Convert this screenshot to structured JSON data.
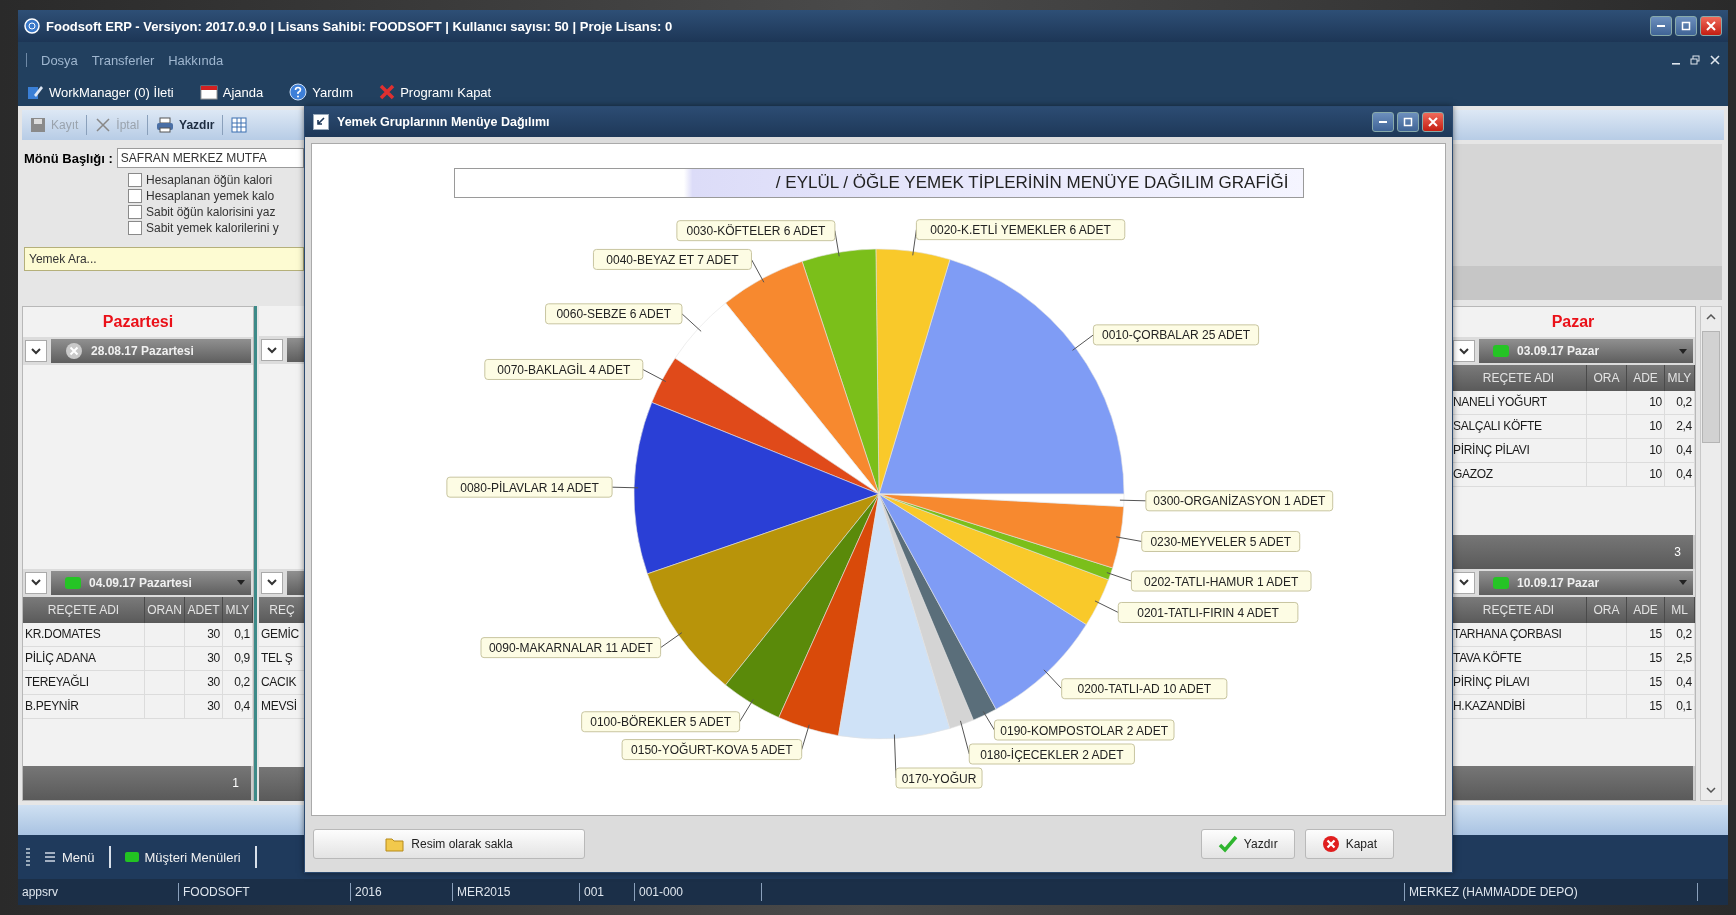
{
  "window": {
    "title": "Foodsoft ERP - Versiyon: 2017.0.9.0 | Lisans Sahibi: FOODSOFT | Kullanıcı sayısı: 50 | Proje Lisans: 0"
  },
  "menu": [
    "Dosya",
    "Transferler",
    "Hakkında"
  ],
  "toolbar": [
    {
      "label": "WorkManager (0) İleti",
      "kind": "workmanager"
    },
    {
      "label": "Ajanda",
      "kind": "calendar"
    },
    {
      "label": "Yardım",
      "kind": "help"
    },
    {
      "label": "Programı Kapat",
      "kind": "exit"
    }
  ],
  "edit_toolbar": [
    {
      "label": "Kayıt",
      "kind": "save",
      "disabled": true
    },
    {
      "label": "İptal",
      "kind": "cancel",
      "disabled": true
    },
    {
      "label": "Yazdır",
      "kind": "print",
      "disabled": false
    }
  ],
  "form": {
    "label": "Mönü Başlığı :",
    "value": "SAFRAN MERKEZ MUTFA",
    "options": [
      {
        "label": "Hesaplanan öğün kalori",
        "checked": false
      },
      {
        "label": "Hesaplanan yemek kalo",
        "checked": false
      },
      {
        "label": "Sabit öğün kalorisini yaz",
        "checked": false
      },
      {
        "label": "Sabit yemek kalorilerini y",
        "checked": false
      }
    ],
    "search": {
      "placeholder": "Yemek Ara..."
    }
  },
  "left_day": {
    "day": "Pazartesi",
    "blocks": [
      {
        "date": "28.08.17 Pazartesi",
        "kind": "closed"
      },
      {
        "date": "04.09.17 Pazartesi",
        "kind": "active",
        "columns": [
          "REÇETE ADI",
          "ORAN",
          "ADET",
          "MLY"
        ],
        "rows": [
          {
            "name": "KR.DOMATES",
            "count": "30",
            "mly": "0,1"
          },
          {
            "name": "PİLİÇ ADANA",
            "count": "30",
            "mly": "0,9"
          },
          {
            "name": "TEREYAĞLI",
            "count": "30",
            "mly": "0,2"
          },
          {
            "name": "B.PEYNİR",
            "count": "30",
            "mly": "0,4"
          }
        ],
        "footer": "1"
      }
    ]
  },
  "partial_column": {
    "header": "REÇ",
    "cells": [
      "GEMİC",
      "TEL Ş",
      "CACIK",
      "MEVSİ"
    ]
  },
  "right_day": {
    "day": "Pazar",
    "blocks": [
      {
        "date": "03.09.17 Pazar",
        "kind": "active",
        "columns": [
          "REÇETE ADI",
          "ORA",
          "ADE",
          "MLY"
        ],
        "rows": [
          {
            "name": "NANELİ YOĞURT",
            "count": "10",
            "mly": "0,2"
          },
          {
            "name": "SALÇALI KÖFTE",
            "count": "10",
            "mly": "2,4"
          },
          {
            "name": "PİRİNÇ PİLAVI",
            "count": "10",
            "mly": "0,4"
          },
          {
            "name": "GAZOZ",
            "count": "10",
            "mly": "0,4"
          }
        ],
        "footer": "3"
      },
      {
        "date": "10.09.17 Pazar",
        "kind": "active",
        "columns": [
          "REÇETE ADI",
          "ORA",
          "ADE",
          "ML"
        ],
        "rows": [
          {
            "name": "TARHANA ÇORBASI",
            "count": "15",
            "mly": "0,2"
          },
          {
            "name": "TAVA KÖFTE",
            "count": "15",
            "mly": "2,5"
          },
          {
            "name": "PİRİNÇ PİLAVI",
            "count": "15",
            "mly": "0,4"
          },
          {
            "name": "H.KAZANDİBİ",
            "count": "15",
            "mly": "0,1"
          }
        ]
      }
    ]
  },
  "dialog": {
    "title": "Yemek Gruplarının Menüye Dağılımı",
    "chart_title": "/ EYLÜL / ÖĞLE YEMEK TİPLERİNİN MENÜYE DAĞILIM GRAFİĞİ",
    "chart_data": {
      "type": "pie",
      "categories": [
        "0010-ÇORBALAR",
        "0020-K.ETLİ YEMEKLER",
        "0030-KÖFTELER",
        "0040-BEYAZ ET",
        "0060-SEBZE",
        "0070-BAKLAGİL",
        "0080-PİLAVLAR",
        "0090-MAKARNALAR",
        "0100-BÖREKLER",
        "0150-YOĞURT-KOVA",
        "0170-YOĞUR",
        "0180-İÇECEKLER",
        "0190-KOMPOSTOLAR",
        "0200-TATLI-AD",
        "0201-TATLI-FIRIN",
        "0202-TATLI-HAMUR",
        "0230-MEYVELER",
        "0300-ORGANİZASYON"
      ],
      "values": [
        25,
        6,
        6,
        7,
        6,
        4,
        14,
        11,
        5,
        5,
        9,
        2,
        2,
        10,
        4,
        1,
        5,
        1
      ],
      "value_labels": [
        "25 ADET",
        "6 ADET",
        "6 ADET",
        "7 ADET",
        "6 ADET",
        "4 ADET",
        "14 ADET",
        "11 ADET",
        "5 ADET",
        "5 ADET",
        null,
        "2 ADET",
        "2 ADET",
        "10 ADET",
        "4 ADET",
        "1 ADET",
        "5 ADET",
        "1 ADET"
      ]
    },
    "buttons": [
      {
        "label": "Resim olarak sakla",
        "kind": "save-image"
      },
      {
        "label": "Yazdır",
        "kind": "print"
      },
      {
        "label": "Kapat",
        "kind": "close"
      }
    ]
  },
  "taskbar": [
    {
      "label": "Menü",
      "kind": "menu"
    },
    {
      "label": "Müşteri Menüleri",
      "kind": "customer-menus"
    }
  ],
  "status_bar": [
    "appsrv",
    "FOODSOFT",
    "2016",
    "MER2015",
    "001",
    "001-000",
    "MERKEZ (HAMMADDE DEPO)"
  ]
}
